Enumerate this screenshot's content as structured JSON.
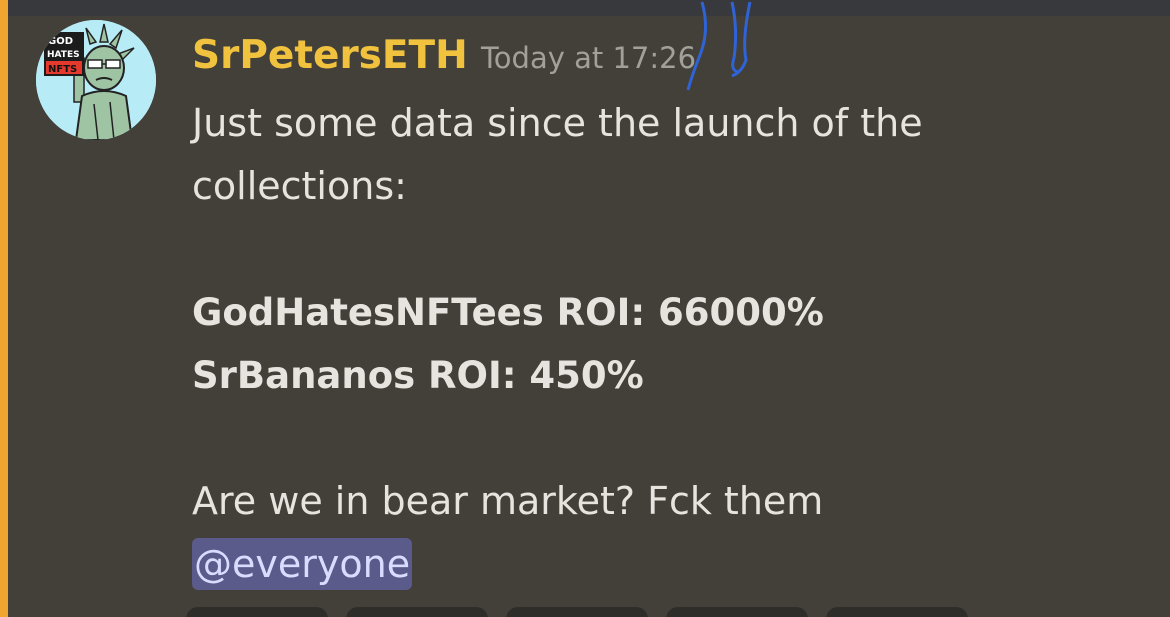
{
  "message": {
    "author": "SrPetersETH",
    "timestamp": "Today at 17:26",
    "lines": [
      "Just some data since the launch of the",
      "collections:",
      "GodHatesNFTees ROI: 66000%",
      "SrBananos ROI: 450%",
      "Are we in bear market? Fck them",
      "@everyone"
    ]
  },
  "avatar": {
    "badge_lines": [
      "GOD",
      "HATES",
      "NFTS"
    ]
  },
  "colors": {
    "background": "#433f39",
    "username": "#f0c23e",
    "mention_bg": "#5a5b8b",
    "mention_text": "#dadcff",
    "highlight_stripe": "#f0a531",
    "timestamp": "#a2a09a",
    "body_text": "#e7e4df"
  }
}
